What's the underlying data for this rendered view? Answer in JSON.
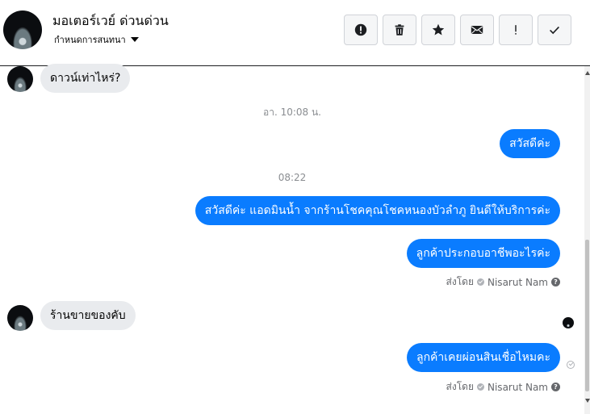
{
  "header": {
    "title": "มอเตอร์เวย์ ด่วนด่วน",
    "subtitle": "กำหนดการสนทนา"
  },
  "toolbar": {
    "buttons": [
      {
        "icon": "alert-circle-icon"
      },
      {
        "icon": "trash-icon"
      },
      {
        "icon": "star-icon"
      },
      {
        "icon": "envelope-icon"
      },
      {
        "icon": "exclamation-icon",
        "glyph": "!"
      },
      {
        "icon": "checkmark-icon"
      }
    ]
  },
  "thread": {
    "messages": [
      {
        "direction": "in",
        "text": "ดาวน์เท่าไหร่?"
      },
      {
        "type": "timestamp",
        "text": "อา. 10:08 น."
      },
      {
        "direction": "out",
        "text": "สวัสดีค่ะ"
      },
      {
        "type": "timestamp",
        "text": "08:22"
      },
      {
        "direction": "out",
        "text": "สวัสดีค่ะ แอดมินน้ำ จากร้านโชคคุณโชคหนองบัวลำภู ยินดีให้บริการค่ะ"
      },
      {
        "direction": "out",
        "text": "ลูกค้าประกอบอาชีพอะไรค่ะ"
      },
      {
        "type": "sent_by",
        "prefix": "ส่งโดย",
        "name": "Nisarut Nam"
      },
      {
        "direction": "in",
        "text": "ร้านขายของคับ"
      },
      {
        "direction": "out",
        "text": "ลูกค้าเคยผ่อนสินเชื่อไหมคะ"
      },
      {
        "type": "sent_by",
        "prefix": "ส่งโดย",
        "name": "Nisarut Nam"
      }
    ]
  },
  "colors": {
    "outgoing_bubble": "#0a7cff",
    "incoming_bubble": "#e9ebee",
    "timestamp_text": "#8a8d91"
  }
}
